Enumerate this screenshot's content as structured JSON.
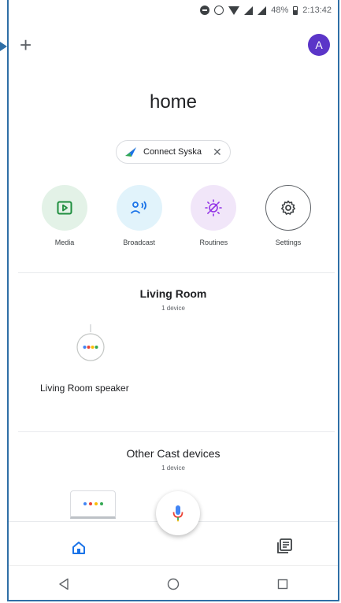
{
  "status_bar": {
    "battery": "48%",
    "time": "2:13:42"
  },
  "header": {
    "avatar_initial": "A"
  },
  "home": {
    "title": "home"
  },
  "connect_chip": {
    "label": "Connect Syska",
    "close": "✕"
  },
  "actions": [
    {
      "label": "Media",
      "icon": "play-icon",
      "color": "#1e8e3e"
    },
    {
      "label": "Broadcast",
      "icon": "broadcast-icon",
      "color": "#1a73e8"
    },
    {
      "label": "Routines",
      "icon": "routines-icon",
      "color": "#9334e6"
    },
    {
      "label": "Settings",
      "icon": "gear-icon",
      "color": "#3c4043"
    }
  ],
  "rooms": [
    {
      "name": "Living Room",
      "count": "1 device",
      "devices": [
        {
          "label": "Living Room speaker",
          "icon": "speaker-icon"
        }
      ]
    }
  ],
  "other": {
    "title": "Other Cast devices",
    "count": "1 device"
  },
  "colors": {
    "accent": "#1a73e8",
    "avatar": "#5b35c8",
    "google_dots": [
      "#4285f4",
      "#ea4335",
      "#fbbc04",
      "#34a853"
    ]
  }
}
